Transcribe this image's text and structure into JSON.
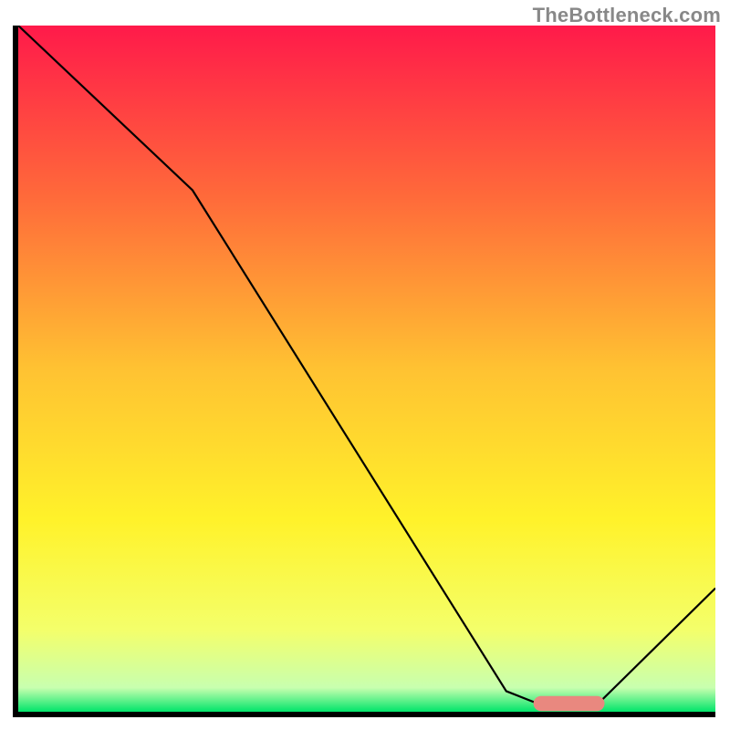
{
  "watermark": "TheBottleneck.com",
  "chart_data": {
    "type": "line",
    "title": "",
    "xlabel": "",
    "ylabel": "",
    "xlim": [
      0,
      100
    ],
    "ylim": [
      0,
      100
    ],
    "grid": false,
    "legend": false,
    "background_gradient": {
      "stops": [
        {
          "pos": 0.0,
          "color": "#ff1a4a"
        },
        {
          "pos": 0.25,
          "color": "#ff6a3a"
        },
        {
          "pos": 0.5,
          "color": "#ffc232"
        },
        {
          "pos": 0.72,
          "color": "#fff22a"
        },
        {
          "pos": 0.88,
          "color": "#f4ff6a"
        },
        {
          "pos": 0.965,
          "color": "#c8ffaf"
        },
        {
          "pos": 1.0,
          "color": "#00e56a"
        }
      ]
    },
    "series": [
      {
        "name": "bottleneck-curve",
        "color": "#000000",
        "x": [
          0,
          25,
          70,
          75,
          83,
          100
        ],
        "y": [
          100,
          76,
          3,
          1,
          1,
          18
        ]
      }
    ],
    "marker": {
      "name": "optimal-range",
      "color": "#e9887f",
      "x_start": 75,
      "x_end": 83,
      "y": 1.2,
      "thickness": 2.2
    }
  }
}
